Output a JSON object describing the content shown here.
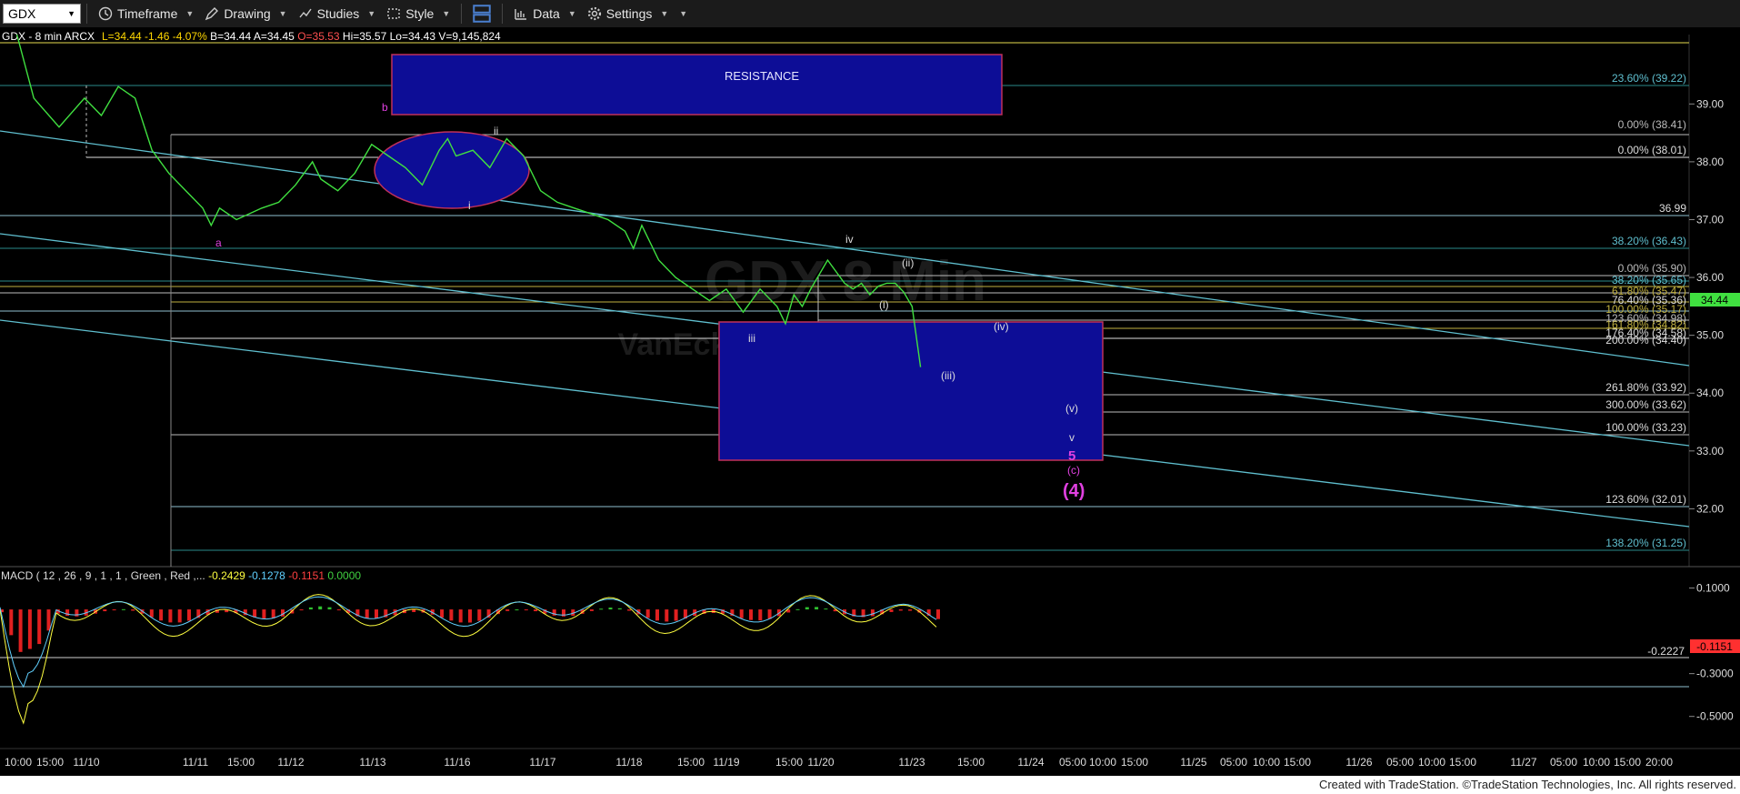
{
  "toolbar": {
    "symbol": "GDX",
    "timeframe_label": "Timeframe",
    "drawing_label": "Drawing",
    "studies_label": "Studies",
    "style_label": "Style",
    "data_label": "Data",
    "settings_label": "Settings"
  },
  "header": {
    "symbol_info": "GDX - 8 min  ARCX",
    "quote": [
      {
        "text": "L=34.44",
        "color": "#ffd700"
      },
      {
        "text": "-1.46",
        "color": "#ffd700"
      },
      {
        "text": "-4.07%",
        "color": "#ffd700"
      },
      {
        "text": "B=34.44",
        "color": "#ffffff"
      },
      {
        "text": "A=34.45",
        "color": "#ffffff"
      },
      {
        "text": "O=35.53",
        "color": "#ff5050"
      },
      {
        "text": "Hi=35.57",
        "color": "#ffffff"
      },
      {
        "text": "Lo=34.43",
        "color": "#ffffff"
      },
      {
        "text": "V=9,145,824",
        "color": "#ffffff"
      }
    ]
  },
  "watermark": {
    "big": "GDX 8 Min",
    "small": "VanEck"
  },
  "chart_data": [
    {
      "type": "line",
      "ylim": [
        31.0,
        40.2
      ],
      "y_ticks": [
        "39.00",
        "38.00",
        "37.00",
        "36.00",
        "35.00",
        "34.00",
        "33.00",
        "32.00"
      ],
      "last_price": "34.44",
      "x_labels": [
        "10:00",
        "15:00",
        "11/10",
        "11/11",
        "15:00",
        "11/12",
        "11/13",
        "11/16",
        "11/17",
        "11/18",
        "15:00",
        "11/19",
        "15:00",
        "11/20",
        "11/23",
        "15:00",
        "11/24",
        "05:00",
        "10:00",
        "15:00",
        "11/25",
        "05:00",
        "10:00",
        "15:00",
        "11/26",
        "05:00",
        "10:00",
        "15:00",
        "11/27",
        "05:00",
        "10:00",
        "15:00",
        "20:00"
      ],
      "price_path": [
        [
          0.01,
          40.2
        ],
        [
          0.02,
          39.1
        ],
        [
          0.035,
          38.6
        ],
        [
          0.05,
          39.1
        ],
        [
          0.06,
          38.8
        ],
        [
          0.07,
          39.3
        ],
        [
          0.08,
          39.1
        ],
        [
          0.09,
          38.2
        ],
        [
          0.1,
          37.8
        ],
        [
          0.11,
          37.5
        ],
        [
          0.12,
          37.2
        ],
        [
          0.125,
          36.9
        ],
        [
          0.13,
          37.2
        ],
        [
          0.14,
          37.0
        ],
        [
          0.155,
          37.2
        ],
        [
          0.165,
          37.3
        ],
        [
          0.175,
          37.6
        ],
        [
          0.185,
          38.0
        ],
        [
          0.19,
          37.7
        ],
        [
          0.2,
          37.5
        ],
        [
          0.21,
          37.8
        ],
        [
          0.22,
          38.3
        ],
        [
          0.23,
          38.1
        ],
        [
          0.24,
          37.9
        ],
        [
          0.25,
          37.6
        ],
        [
          0.26,
          38.2
        ],
        [
          0.265,
          38.4
        ],
        [
          0.27,
          38.1
        ],
        [
          0.28,
          38.2
        ],
        [
          0.29,
          37.9
        ],
        [
          0.3,
          38.4
        ],
        [
          0.31,
          38.1
        ],
        [
          0.32,
          37.5
        ],
        [
          0.33,
          37.3
        ],
        [
          0.34,
          37.2
        ],
        [
          0.35,
          37.1
        ],
        [
          0.36,
          37.0
        ],
        [
          0.37,
          36.8
        ],
        [
          0.375,
          36.5
        ],
        [
          0.38,
          36.9
        ],
        [
          0.39,
          36.3
        ],
        [
          0.4,
          36.0
        ],
        [
          0.41,
          35.8
        ],
        [
          0.42,
          35.6
        ],
        [
          0.43,
          35.8
        ],
        [
          0.44,
          35.4
        ],
        [
          0.45,
          35.8
        ],
        [
          0.46,
          35.5
        ],
        [
          0.465,
          35.2
        ],
        [
          0.47,
          35.7
        ],
        [
          0.475,
          35.5
        ],
        [
          0.48,
          35.8
        ],
        [
          0.49,
          36.3
        ],
        [
          0.5,
          35.9
        ],
        [
          0.505,
          35.8
        ],
        [
          0.51,
          35.9
        ],
        [
          0.515,
          35.7
        ],
        [
          0.52,
          35.85
        ],
        [
          0.525,
          35.9
        ],
        [
          0.53,
          35.9
        ],
        [
          0.535,
          35.75
        ],
        [
          0.54,
          35.5
        ],
        [
          0.545,
          34.45
        ]
      ],
      "title": "",
      "xlabel": "",
      "ylabel": ""
    },
    {
      "type": "line",
      "title": "MACD ( 12 , 26 , 9 , 1 , 1 , Green , Red ,...",
      "values_text": [
        {
          "text": "-0.2429",
          "color": "#ffff40"
        },
        {
          "text": "-0.1278",
          "color": "#60d0ff"
        },
        {
          "text": "-0.1151",
          "color": "#ff4040"
        },
        {
          "text": "0.0000",
          "color": "#40d040"
        }
      ],
      "ylim": [
        -0.65,
        0.2
      ],
      "y_ticks": [
        "0.1000",
        "-0.3000",
        "-0.5000"
      ],
      "ref_line": "-0.2227",
      "last_value": "-0.1151"
    }
  ],
  "annotations": {
    "resistance_label": "RESISTANCE",
    "fib_labels": [
      "23.60% (39.22)",
      "0.00% (38.41)",
      "0.00% (38.01)",
      "36.99",
      "38.20% (36.43)",
      "0.00% (35.90)",
      "38.20% (35.65)",
      "61.80% (35.47)",
      "76.40% (35.36)",
      "100.00% (35.17)",
      "123.60% (34.98)",
      "161.80% (34.82)",
      "176.40% (34.58)",
      "200.00% (34.40)",
      "261.80% (33.92)",
      "300.00% (33.62)",
      "100.00% (33.23)",
      "123.60% (32.01)",
      "138.20% (31.25)"
    ],
    "wave_labels": [
      "b",
      "a",
      "ii",
      "i",
      "iv",
      "(ii)",
      "(i)",
      "iii",
      "(iv)",
      "(iii)",
      "(v)",
      "v",
      "5",
      "(c)",
      "(4)"
    ]
  },
  "footer_text": "Created with TradeStation. ©TradeStation Technologies, Inc. All rights reserved."
}
